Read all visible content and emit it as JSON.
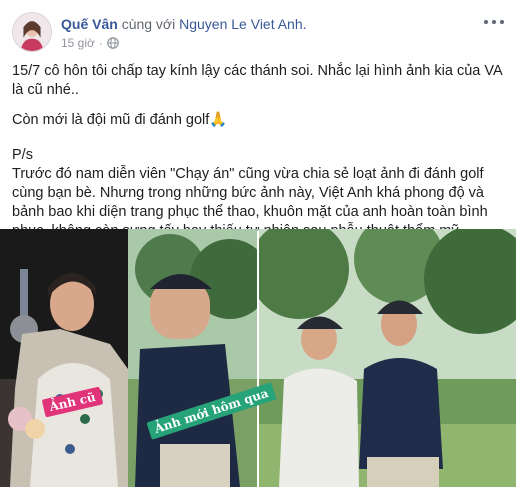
{
  "post": {
    "author": "Quế Vân",
    "with_text": "cùng với",
    "tagged_user": "Nguyen Le Viet Anh.",
    "timestamp": "15 giờ",
    "privacy_icon": "globe-icon",
    "options_icon": "more-options-icon"
  },
  "content": {
    "line1": "15/7 cô hôn tôi chấp tay kính lậy các thánh soi. Nhắc lại hình ảnh kia của VA là cũ nhé..",
    "line2": "Còn mới là đội mũ đi đánh golf🙏",
    "ps": "P/s",
    "paragraph": "Trước đó nam diễn viên \"Chạy án\" cũng vừa chia sẻ loạt ảnh đi đánh golf cùng bạn bè. Nhưng trong những bức ảnh này, Việt Anh khá phong độ và bảnh bao khi diện trang phục thể thao, khuôn mặt của anh hoàn toàn bình phục, không còn sưng tấy hay thiếu tự nhiên sau phẫu thuật thẩm mỹ"
  },
  "photos": {
    "label_old": "Ảnh cũ",
    "label_new": "Ảnh mới hôm qua"
  }
}
